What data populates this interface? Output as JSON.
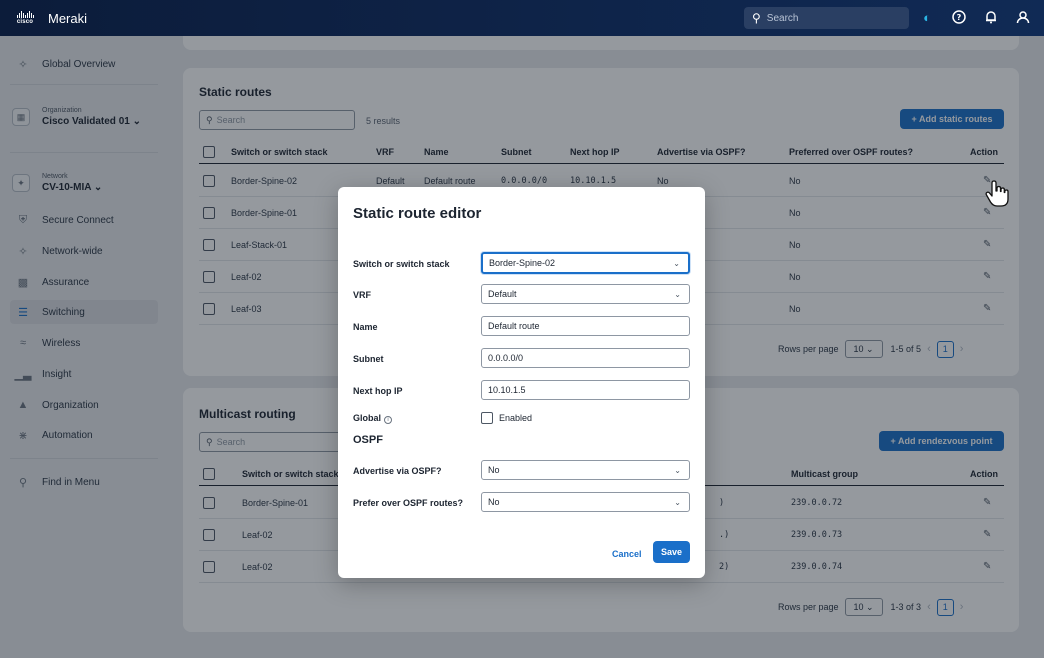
{
  "topbar": {
    "logo_text": "cisco",
    "brand": "Meraki",
    "search_placeholder": "Search",
    "icons": [
      "assistant-icon",
      "help-icon",
      "bell-icon",
      "user-icon"
    ]
  },
  "sidebar": {
    "global_overview": "Global Overview",
    "organization_label": "Organization",
    "organization_value": "Cisco Validated 01",
    "network_label": "Network",
    "network_value": "CV-10-MIA",
    "items": [
      {
        "label": "Secure Connect",
        "icon": "shield-icon"
      },
      {
        "label": "Network-wide",
        "icon": "network-icon"
      },
      {
        "label": "Assurance",
        "icon": "assurance-icon"
      },
      {
        "label": "Switching",
        "icon": "switch-icon"
      },
      {
        "label": "Wireless",
        "icon": "wifi-icon"
      },
      {
        "label": "Insight",
        "icon": "chart-icon"
      },
      {
        "label": "Organization",
        "icon": "org-icon"
      },
      {
        "label": "Automation",
        "icon": "automation-icon"
      }
    ],
    "find_in_menu": "Find in Menu",
    "active": "Switching"
  },
  "static_routes": {
    "title": "Static routes",
    "search_placeholder": "Search",
    "results": "5 results",
    "add_button": "+ Add static routes",
    "columns": [
      "Switch or switch stack",
      "VRF",
      "Name",
      "Subnet",
      "Next hop IP",
      "Advertise via OSPF?",
      "Preferred over OSPF routes?",
      "Action"
    ],
    "rows": [
      {
        "switch": "Border-Spine-02",
        "vrf": "Default",
        "name": "Default route",
        "subnet": "0.0.0.0/0",
        "next_hop": "10.10.1.5",
        "advertise": "No",
        "preferred": "No"
      },
      {
        "switch": "Border-Spine-01",
        "vrf": "",
        "name": "",
        "subnet": "",
        "next_hop": "",
        "advertise": "",
        "preferred": "No"
      },
      {
        "switch": "Leaf-Stack-01",
        "vrf": "",
        "name": "",
        "subnet": "",
        "next_hop": "",
        "advertise": "",
        "preferred": "No"
      },
      {
        "switch": "Leaf-02",
        "vrf": "",
        "name": "",
        "subnet": "",
        "next_hop": "",
        "advertise": "",
        "preferred": "No"
      },
      {
        "switch": "Leaf-03",
        "vrf": "",
        "name": "",
        "subnet": "",
        "next_hop": "",
        "advertise": "",
        "preferred": "No"
      }
    ],
    "pager": {
      "rows_label": "Rows per page",
      "rows_value": "10",
      "range": "1-5 of 5",
      "page": "1"
    }
  },
  "multicast": {
    "title": "Multicast routing",
    "search_placeholder": "Search",
    "add_button": "+ Add rendezvous point",
    "columns": [
      "Switch or switch stack",
      "Multicast group",
      "Action"
    ],
    "rows": [
      {
        "switch": "Border-Spine-01",
        "partial": ")",
        "group": "239.0.0.72"
      },
      {
        "switch": "Leaf-02",
        "partial": ".)",
        "group": "239.0.0.73"
      },
      {
        "switch": "Leaf-02",
        "partial": "2)",
        "group": "239.0.0.74"
      }
    ],
    "pager": {
      "rows_label": "Rows per page",
      "rows_value": "10",
      "range": "1-3 of 3",
      "page": "1"
    }
  },
  "modal": {
    "title": "Static route editor",
    "fields": {
      "switch_label": "Switch or switch stack",
      "switch_value": "Border-Spine-02",
      "vrf_label": "VRF",
      "vrf_value": "Default",
      "name_label": "Name",
      "name_value": "Default route",
      "subnet_label": "Subnet",
      "subnet_value": "0.0.0.0/0",
      "nexthop_label": "Next hop IP",
      "nexthop_value": "10.10.1.5",
      "global_label": "Global",
      "global_checkbox": "Enabled"
    },
    "ospf_section": "OSPF",
    "advertise_label": "Advertise via OSPF?",
    "advertise_value": "No",
    "prefer_label": "Prefer over OSPF routes?",
    "prefer_value": "No",
    "cancel": "Cancel",
    "save": "Save"
  },
  "colors": {
    "accent": "#1a6fc9",
    "topbar": "#0c1c3a"
  }
}
